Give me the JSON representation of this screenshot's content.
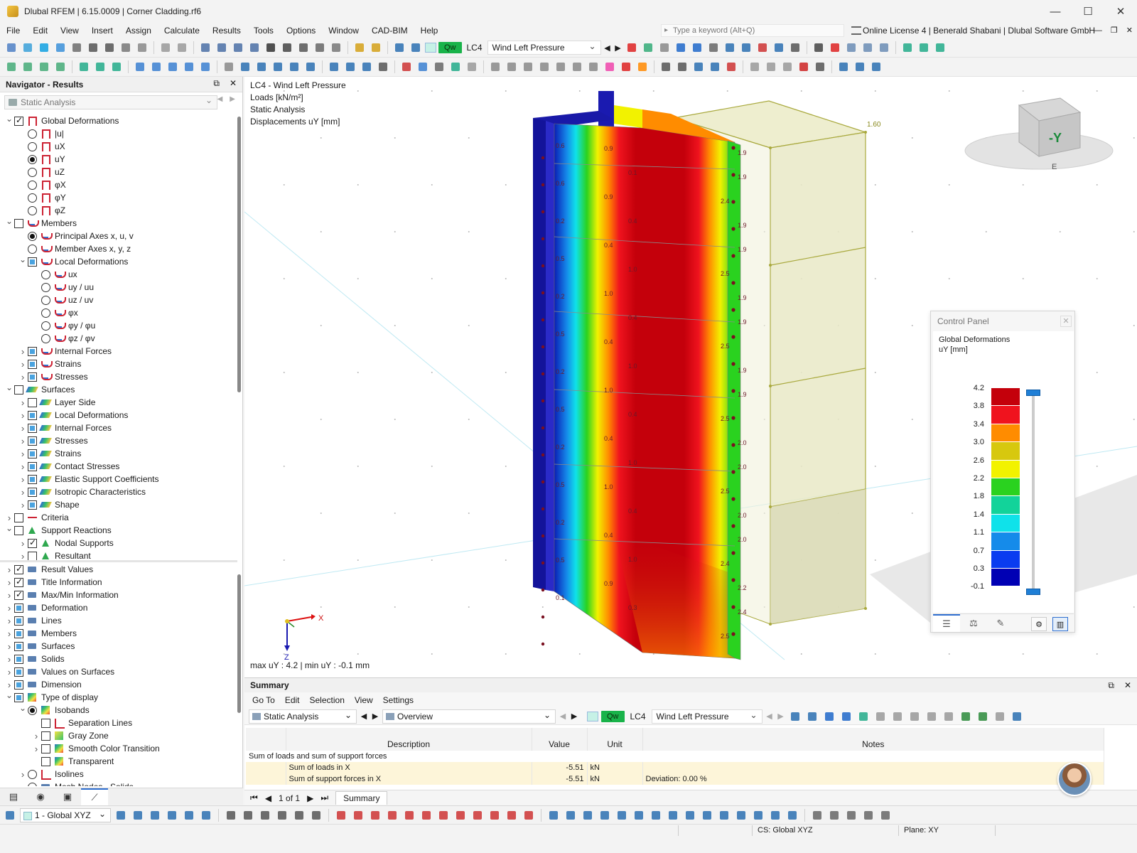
{
  "window": {
    "title": "Dlubal RFEM | 6.15.0009 | Corner Cladding.rf6",
    "controls": [
      "—",
      "☐",
      "✕"
    ]
  },
  "menu": {
    "items": [
      "File",
      "Edit",
      "View",
      "Insert",
      "Assign",
      "Calculate",
      "Results",
      "Tools",
      "Options",
      "Window",
      "CAD-BIM",
      "Help"
    ],
    "search_placeholder": "Type a keyword (Alt+Q)",
    "license": "Online License 4 | Benerald Shabani | Dlubal Software GmbH"
  },
  "toolbar": {
    "load_case_badge": "Qw",
    "load_case_id": "LC4",
    "load_case_name": "Wind Left Pressure"
  },
  "navigator": {
    "title": "Navigator - Results",
    "combo": "Static Analysis",
    "tree_top": [
      {
        "label": "Global Deformations",
        "level": 0,
        "exp": "v",
        "ctl": "chk-on",
        "icon": "deform"
      },
      {
        "label": "|u|",
        "level": 1,
        "ctl": "rad",
        "icon": "deform"
      },
      {
        "label": "uX",
        "level": 1,
        "ctl": "rad",
        "icon": "deform"
      },
      {
        "label": "uY",
        "level": 1,
        "ctl": "rad-on",
        "icon": "deform"
      },
      {
        "label": "uZ",
        "level": 1,
        "ctl": "rad",
        "icon": "deform"
      },
      {
        "label": "φX",
        "level": 1,
        "ctl": "rad",
        "icon": "deform"
      },
      {
        "label": "φY",
        "level": 1,
        "ctl": "rad",
        "icon": "deform"
      },
      {
        "label": "φZ",
        "level": 1,
        "ctl": "rad",
        "icon": "deform"
      },
      {
        "label": "Members",
        "level": 0,
        "exp": "v",
        "ctl": "chk",
        "icon": "member"
      },
      {
        "label": "Principal Axes x, u, v",
        "level": 1,
        "ctl": "rad-on",
        "icon": "member"
      },
      {
        "label": "Member Axes x, y, z",
        "level": 1,
        "ctl": "rad",
        "icon": "member"
      },
      {
        "label": "Local Deformations",
        "level": 1,
        "exp": "v",
        "ctl": "chk-partial",
        "icon": "member"
      },
      {
        "label": "ux",
        "level": 2,
        "ctl": "rad",
        "icon": "member"
      },
      {
        "label": "uy / uu",
        "level": 2,
        "ctl": "rad",
        "icon": "member"
      },
      {
        "label": "uz / uv",
        "level": 2,
        "ctl": "rad",
        "icon": "member"
      },
      {
        "label": "φx",
        "level": 2,
        "ctl": "rad",
        "icon": "member"
      },
      {
        "label": "φy / φu",
        "level": 2,
        "ctl": "rad",
        "icon": "member"
      },
      {
        "label": "φz / φv",
        "level": 2,
        "ctl": "rad",
        "icon": "member"
      },
      {
        "label": "Internal Forces",
        "level": 1,
        "exp": ">",
        "ctl": "chk-partial",
        "icon": "member"
      },
      {
        "label": "Strains",
        "level": 1,
        "exp": ">",
        "ctl": "chk-partial",
        "icon": "member"
      },
      {
        "label": "Stresses",
        "level": 1,
        "exp": ">",
        "ctl": "chk-partial",
        "icon": "member"
      },
      {
        "label": "Surfaces",
        "level": 0,
        "exp": "v",
        "ctl": "chk",
        "icon": "surface"
      },
      {
        "label": "Layer Side",
        "level": 1,
        "exp": ">",
        "ctl": "chk",
        "icon": "surface"
      },
      {
        "label": "Local Deformations",
        "level": 1,
        "exp": ">",
        "ctl": "chk-partial",
        "icon": "surface"
      },
      {
        "label": "Internal Forces",
        "level": 1,
        "exp": ">",
        "ctl": "chk-partial",
        "icon": "surface"
      },
      {
        "label": "Stresses",
        "level": 1,
        "exp": ">",
        "ctl": "chk-partial",
        "icon": "surface"
      },
      {
        "label": "Strains",
        "level": 1,
        "exp": ">",
        "ctl": "chk-partial",
        "icon": "surface"
      },
      {
        "label": "Contact Stresses",
        "level": 1,
        "exp": ">",
        "ctl": "chk-partial",
        "icon": "surface"
      },
      {
        "label": "Elastic Support Coefficients",
        "level": 1,
        "exp": ">",
        "ctl": "chk-partial",
        "icon": "surface"
      },
      {
        "label": "Isotropic Characteristics",
        "level": 1,
        "exp": ">",
        "ctl": "chk-partial",
        "icon": "surface"
      },
      {
        "label": "Shape",
        "level": 1,
        "exp": ">",
        "ctl": "chk-partial",
        "icon": "surface"
      },
      {
        "label": "Criteria",
        "level": 0,
        "exp": ">",
        "ctl": "chk",
        "icon": "criteria"
      },
      {
        "label": "Support Reactions",
        "level": 0,
        "exp": "v",
        "ctl": "chk",
        "icon": "support"
      },
      {
        "label": "Nodal Supports",
        "level": 1,
        "exp": ">",
        "ctl": "chk-on",
        "icon": "support"
      },
      {
        "label": "Resultant",
        "level": 1,
        "exp": ">",
        "ctl": "chk",
        "icon": "support"
      }
    ],
    "tree_bottom": [
      {
        "label": "Result Values",
        "level": 0,
        "exp": ">",
        "ctl": "chk-on",
        "icon": "generic"
      },
      {
        "label": "Title Information",
        "level": 0,
        "exp": ">",
        "ctl": "chk-on",
        "icon": "generic"
      },
      {
        "label": "Max/Min Information",
        "level": 0,
        "exp": ">",
        "ctl": "chk-on",
        "icon": "generic"
      },
      {
        "label": "Deformation",
        "level": 0,
        "exp": ">",
        "ctl": "chk-partial",
        "icon": "generic"
      },
      {
        "label": "Lines",
        "level": 0,
        "exp": ">",
        "ctl": "chk-partial",
        "icon": "generic"
      },
      {
        "label": "Members",
        "level": 0,
        "exp": ">",
        "ctl": "chk-partial",
        "icon": "generic"
      },
      {
        "label": "Surfaces",
        "level": 0,
        "exp": ">",
        "ctl": "chk-partial",
        "icon": "generic"
      },
      {
        "label": "Solids",
        "level": 0,
        "exp": ">",
        "ctl": "chk-partial",
        "icon": "generic"
      },
      {
        "label": "Values on Surfaces",
        "level": 0,
        "exp": ">",
        "ctl": "chk-partial",
        "icon": "generic"
      },
      {
        "label": "Dimension",
        "level": 0,
        "exp": ">",
        "ctl": "chk-partial",
        "icon": "generic"
      },
      {
        "label": "Type of display",
        "level": 0,
        "exp": "v",
        "ctl": "chk-partial",
        "icon": "iso"
      },
      {
        "label": "Isobands",
        "level": 1,
        "exp": "v",
        "ctl": "rad-on",
        "icon": "iso"
      },
      {
        "label": "Separation Lines",
        "level": 2,
        "ctl": "chk",
        "icon": "sep"
      },
      {
        "label": "Gray Zone",
        "level": 2,
        "exp": ">",
        "ctl": "chk",
        "icon": "gray"
      },
      {
        "label": "Smooth Color Transition",
        "level": 2,
        "exp": ">",
        "ctl": "chk",
        "icon": "iso"
      },
      {
        "label": "Transparent",
        "level": 2,
        "ctl": "chk",
        "icon": "iso"
      },
      {
        "label": "Isolines",
        "level": 1,
        "exp": ">",
        "ctl": "rad",
        "icon": "sep"
      },
      {
        "label": "Mesh Nodes - Solids",
        "level": 1,
        "ctl": "rad",
        "icon": "generic"
      }
    ]
  },
  "viewport": {
    "info_lines": [
      "LC4 - Wind Left Pressure",
      "Loads [kN/m²]",
      "Static Analysis",
      "Displacements uY [mm]"
    ],
    "max_min": "max uY : 4.2 | min uY : -0.1 mm",
    "load_value": "1.60",
    "axis_x": "X",
    "axis_z": "Z",
    "cube_label": "-Y",
    "cube_bottom": "E",
    "value_labels_left": [
      "0.6",
      "0.6",
      "0.2",
      "0.5",
      "0.2",
      "0.5",
      "0.2",
      "0.5",
      "0.2",
      "0.5",
      "0.2",
      "0.5",
      "0.1"
    ],
    "value_labels_mid": [
      "0.9",
      "0.1",
      "0.9",
      "0.4",
      "0.4",
      "1.0",
      "1.0",
      "0.4",
      "0.4",
      "1.0",
      "1.0",
      "0.4",
      "0.4",
      "1.0",
      "1.0",
      "0.4",
      "0.4",
      "1.0",
      "0.9",
      "0.3"
    ],
    "value_labels_right": [
      "1.9",
      "1.9",
      "2.4",
      "1.9",
      "1.9",
      "2.5",
      "1.9",
      "1.9",
      "2.5",
      "1.9",
      "1.9",
      "2.5",
      "2.0",
      "2.0",
      "2.5",
      "2.0",
      "2.0",
      "2.4",
      "2.2",
      "2.4",
      "2.5"
    ]
  },
  "control_panel": {
    "title": "Control Panel",
    "heading": "Global Deformations",
    "unit": "uY [mm]",
    "legend_values": [
      "4.2",
      "3.8",
      "3.4",
      "3.0",
      "2.6",
      "2.2",
      "1.8",
      "1.4",
      "1.1",
      "0.7",
      "0.3",
      "-0.1"
    ],
    "legend_colors": [
      "#c4000b",
      "#f0131e",
      "#ff8c00",
      "#d7c80e",
      "#f2f200",
      "#2ad21f",
      "#12d39a",
      "#0fe2ea",
      "#158bea",
      "#0a3cf0",
      "#0000b4"
    ]
  },
  "summary": {
    "title": "Summary",
    "menu": [
      "Go To",
      "Edit",
      "Selection",
      "View",
      "Settings"
    ],
    "analysis": "Static Analysis",
    "view": "Overview",
    "lc_badge": "Qw",
    "lc_id": "LC4",
    "lc_name": "Wind Left Pressure",
    "columns": [
      "Description",
      "Value",
      "Unit",
      "Notes"
    ],
    "group": "Sum of loads and sum of support forces",
    "rows": [
      {
        "description": "Sum of loads in X",
        "value": "-5.51",
        "unit": "kN",
        "notes": ""
      },
      {
        "description": "Sum of support forces in X",
        "value": "-5.51",
        "unit": "kN",
        "notes": "Deviation: 0.00 %"
      }
    ],
    "pager": "1 of 1",
    "tab": "Summary"
  },
  "bottom": {
    "coord_system": "1 - Global XYZ",
    "status_cs": "CS: Global XYZ",
    "status_plane": "Plane: XY"
  }
}
